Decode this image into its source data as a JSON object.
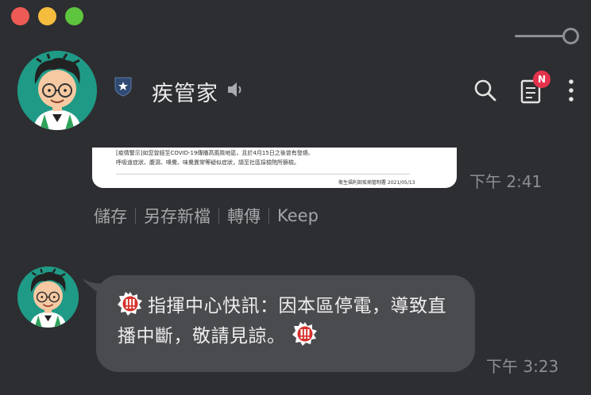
{
  "window": {
    "traffic_lights": {
      "close_color": "#ed5b55",
      "minimize_color": "#f5bc3d",
      "zoom_color": "#5ec53f"
    }
  },
  "header": {
    "title": "疾管家",
    "new_badge": "N",
    "icons": [
      "shield-star-icon",
      "speaker-icon",
      "search-icon",
      "notes-icon",
      "more-icon"
    ]
  },
  "messages": [
    {
      "type": "image",
      "image_lines": [
        "[疫情警示]如您曾經至COVID-19傳播高風險地區，且於4月15日之後曾有發燒、",
        "呼吸道症狀、腹瀉、嗅覺、味覺異常等疑似症狀，請至社區採檢院所篩檢。",
        "衛生福利部疾病管制署    2021/05/13"
      ],
      "time": "下午 2:41",
      "actions": [
        "儲存",
        "另存新檔",
        "轉傳",
        "Keep"
      ]
    },
    {
      "type": "text",
      "text": "指揮中心快訊：因本區停電，導致直播中斷，敬請見諒。",
      "time": "下午 3:23"
    }
  ],
  "colors": {
    "background": "#2d2e31",
    "bubble": "#4a4b4e",
    "avatar_bg": "#1f9a86",
    "badge": "#e5334e",
    "alert": "#d6312b"
  }
}
